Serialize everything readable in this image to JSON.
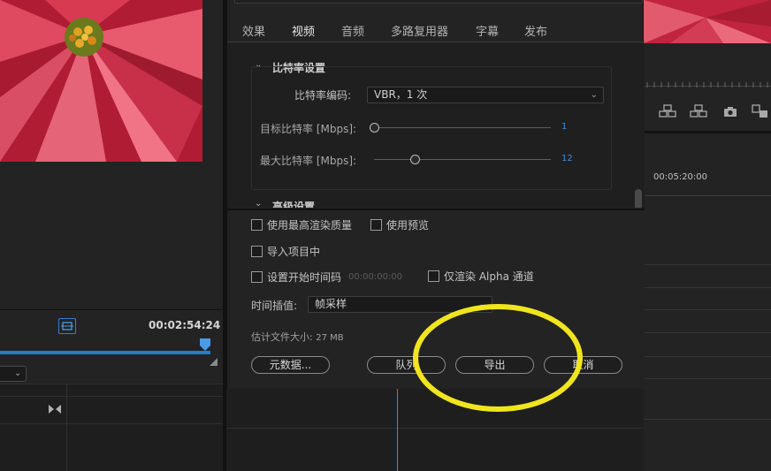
{
  "left_monitor": {
    "timecode": "00:02:54:24"
  },
  "timeline": {
    "timecode": "00:05:20:00"
  },
  "tabs": [
    {
      "label": "效果"
    },
    {
      "label": "视频"
    },
    {
      "label": "音频"
    },
    {
      "label": "多路复用器"
    },
    {
      "label": "字幕"
    },
    {
      "label": "发布"
    }
  ],
  "bitrate": {
    "section_title": "比特率设置",
    "encoding_label": "比特率编码:",
    "encoding_value": "VBR，1 次",
    "target_label": "目标比特率 [Mbps]:",
    "target_value": "1",
    "target_fraction": 0.0,
    "max_label": "最大比特率 [Mbps]:",
    "max_value": "12",
    "max_fraction": 0.23,
    "advanced_title": "高级设置"
  },
  "options": {
    "max_render_quality": "使用最高渲染质量",
    "use_previews": "使用预览",
    "import_into_project": "导入项目中",
    "set_start_timecode": "设置开始时间码",
    "start_timecode_value": "00:00:00:00",
    "render_alpha_only": "仅渲染 Alpha 通道",
    "time_interpolation_label": "时间插值:",
    "time_interpolation_value": "帧采样",
    "est_size_label": "估计文件大小:",
    "est_size_value": "27 MB"
  },
  "buttons": {
    "metadata": "元数据...",
    "queue": "队列",
    "export": "导出",
    "cancel": "取消"
  },
  "colors": {
    "accent_blue": "#3b8fd8",
    "highlight_yellow": "#f0e51e"
  }
}
